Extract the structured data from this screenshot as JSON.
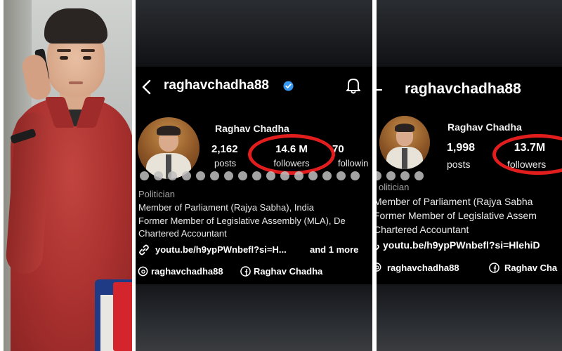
{
  "panel2": {
    "username": "raghavchadha88",
    "display_name": "Raghav Chadha",
    "posts_count": "2,162",
    "posts_label": "posts",
    "followers_count": "14.6 M",
    "followers_label": "followers",
    "following_count": "70",
    "following_label": "followin",
    "category": "Politician",
    "bio": [
      "Member of Parliament (Rajya Sabha), India",
      "Former Member of Legislative Assembly (MLA), De",
      "Chartered Accountant"
    ],
    "link": "youtu.be/h9ypPWnbefl?si=H...",
    "link_more": "and 1 more",
    "threads_handle": "raghavchadha88",
    "facebook_name": "Raghav Chadha"
  },
  "panel3": {
    "username": "raghavchadha88",
    "display_name": "Raghav Chadha",
    "posts_count": "1,998",
    "posts_label": "posts",
    "followers_count": "13.7M",
    "followers_label": "followers",
    "category": "olitician",
    "bio": [
      "Member of Parliament (Rajya Sabha",
      "Former Member of Legislative Assem",
      "Chartered Accountant"
    ],
    "link": "youtu.be/h9ypPWnbefl?si=HlehiD",
    "threads_handle": "raghavchadha88",
    "facebook_name": "Raghav Cha"
  },
  "colors": {
    "highlight_ring": "#e11d1d",
    "verified_badge": "#3897f0",
    "shirt": "#a8302e"
  }
}
